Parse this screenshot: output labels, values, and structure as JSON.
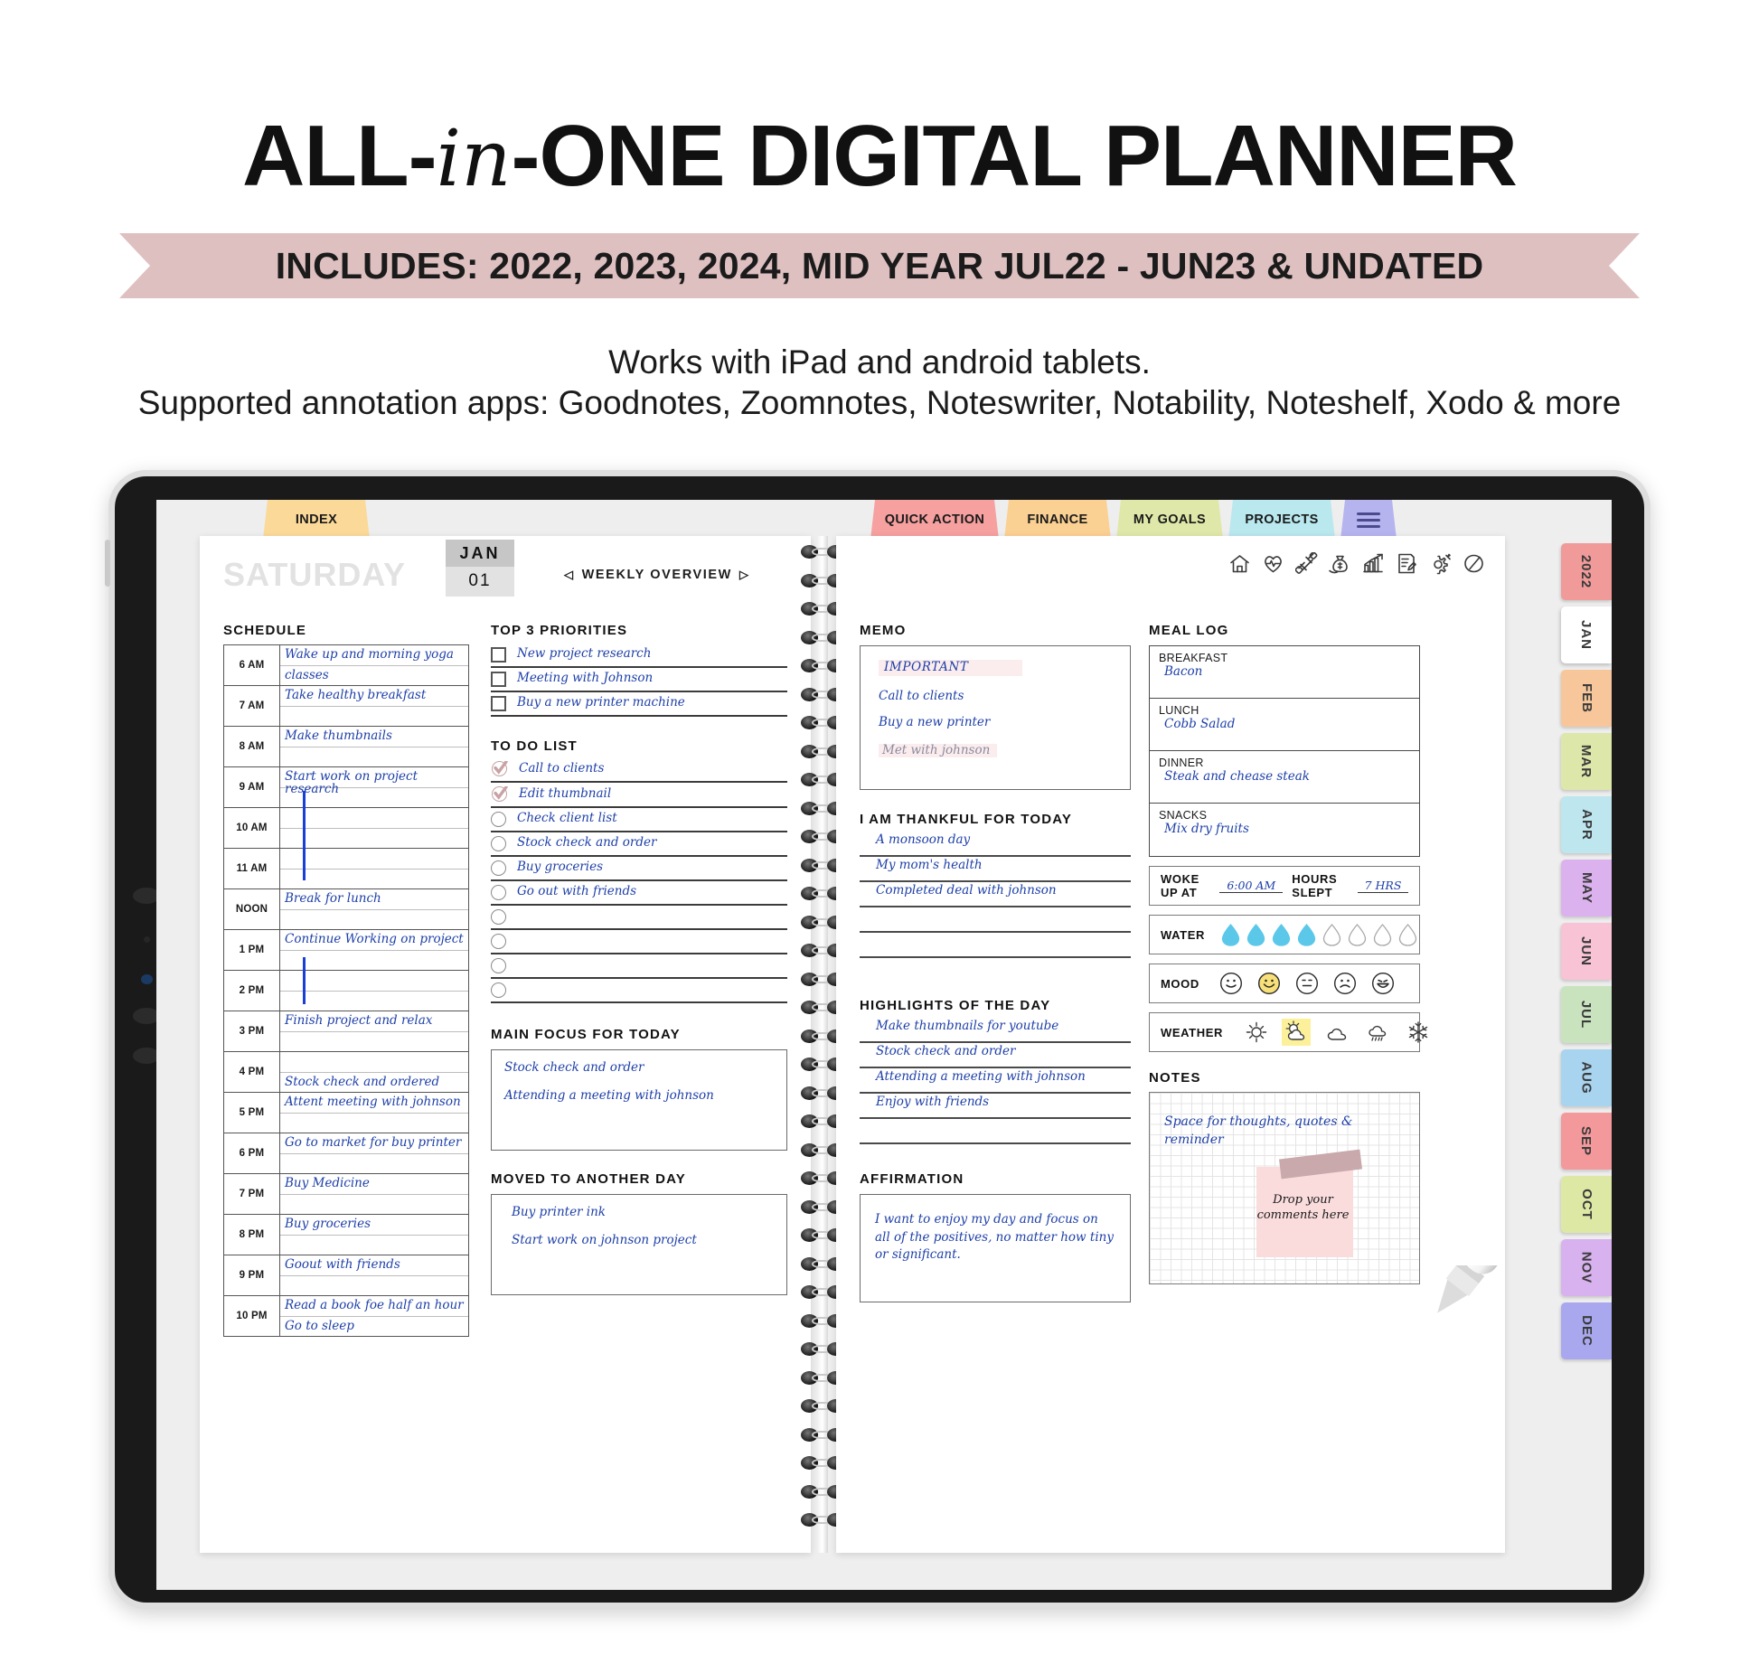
{
  "header": {
    "title_a": "ALL-",
    "title_script": "in",
    "title_b": "-ONE DIGITAL PLANNER",
    "ribbon": "INCLUDES: 2022, 2023, 2024, MID YEAR JUL22 - JUN23 & UNDATED",
    "sub1": "Works with iPad and android tablets.",
    "sub2": "Supported annotation apps: Goodnotes, Zoomnotes, Noteswriter, Notability, Noteshelf, Xodo & more",
    "ribbon_color": "#dfc0c1"
  },
  "top_tabs": [
    {
      "label": "INDEX",
      "color": "#fbd999"
    },
    {
      "label": "QUICK ACTION",
      "color": "#f6a0a0"
    },
    {
      "label": "FINANCE",
      "color": "#fbd093"
    },
    {
      "label": "MY GOALS",
      "color": "#dfe8a8"
    },
    {
      "label": "PROJECTS",
      "color": "#b9e8ee"
    },
    {
      "label": "menu-icon",
      "color": "#b5b4ef"
    }
  ],
  "side_tabs": [
    {
      "label": "2022",
      "color": "#f09a9a"
    },
    {
      "label": "JAN",
      "color": "#ffffff"
    },
    {
      "label": "FEB",
      "color": "#f7c79b"
    },
    {
      "label": "MAR",
      "color": "#dde7a9"
    },
    {
      "label": "APR",
      "color": "#bde6ee"
    },
    {
      "label": "MAY",
      "color": "#dcb2ee"
    },
    {
      "label": "JUN",
      "color": "#f8c3d4"
    },
    {
      "label": "JUL",
      "color": "#c9e3bf"
    },
    {
      "label": "AUG",
      "color": "#a8d4ef"
    },
    {
      "label": "SEP",
      "color": "#f3999c"
    },
    {
      "label": "OCT",
      "color": "#dde8a4"
    },
    {
      "label": "NOV",
      "color": "#d8b2ef"
    },
    {
      "label": "DEC",
      "color": "#a9a8ee"
    }
  ],
  "left_page": {
    "day_name": "SATURDAY",
    "month": "JAN",
    "day_number": "01",
    "weekly_overview": "WEEKLY  OVERVIEW",
    "arrow_prev": "◁",
    "arrow_next": "▷",
    "schedule_title": "SCHEDULE",
    "schedule": [
      {
        "time": "6 AM",
        "line1": "Wake up and morning yoga",
        "line2": "classes"
      },
      {
        "time": "7 AM",
        "line1": "Take healthy breakfast",
        "line2": ""
      },
      {
        "time": "8 AM",
        "line1": "Make thumbnails",
        "line2": ""
      },
      {
        "time": "9 AM",
        "line1": "Start work on project research",
        "line2": ""
      },
      {
        "time": "10 AM",
        "line1": "",
        "line2": ""
      },
      {
        "time": "11 AM",
        "line1": "",
        "line2": ""
      },
      {
        "time": "NOON",
        "line1": "Break for lunch",
        "line2": ""
      },
      {
        "time": "1 PM",
        "line1": "Continue Working on project",
        "line2": ""
      },
      {
        "time": "2 PM",
        "line1": "",
        "line2": ""
      },
      {
        "time": "3 PM",
        "line1": "Finish project and relax",
        "line2": ""
      },
      {
        "time": "4 PM",
        "line1": "",
        "line2": "Stock check and ordered"
      },
      {
        "time": "5 PM",
        "line1": "Attent meeting with johnson",
        "line2": ""
      },
      {
        "time": "6 PM",
        "line1": "Go to market for buy printer",
        "line2": ""
      },
      {
        "time": "7 PM",
        "line1": "Buy Medicine",
        "line2": ""
      },
      {
        "time": "8 PM",
        "line1": "Buy groceries",
        "line2": ""
      },
      {
        "time": "9 PM",
        "line1": "Goout with friends",
        "line2": ""
      },
      {
        "time": "10 PM",
        "line1": "Read a book foe half an hour",
        "line2": "Go to sleep"
      }
    ],
    "priorities_title": "TOP 3 PRIORITIES",
    "priorities": [
      {
        "text": "New project research",
        "checked": false
      },
      {
        "text": "Meeting with Johnson",
        "checked": false
      },
      {
        "text": "Buy a new printer machine",
        "checked": false
      }
    ],
    "todo_title": "TO DO LIST",
    "todo": [
      {
        "text": "Call to clients",
        "done": true
      },
      {
        "text": "Edit thumbnail",
        "done": true
      },
      {
        "text": "Check client list",
        "done": false
      },
      {
        "text": "Stock check and order",
        "done": false
      },
      {
        "text": "Buy groceries",
        "done": false
      },
      {
        "text": "Go out with friends",
        "done": false
      },
      {
        "text": "",
        "done": false
      },
      {
        "text": "",
        "done": false
      },
      {
        "text": "",
        "done": false
      },
      {
        "text": "",
        "done": false
      }
    ],
    "focus_title": "MAIN FOCUS FOR TODAY",
    "focus_items": [
      "Stock check and order",
      "Attending a meeting with johnson"
    ],
    "moved_title": "MOVED TO ANOTHER DAY",
    "moved_items": [
      "Buy printer ink",
      "Start work on johnson project"
    ]
  },
  "right_page": {
    "icons": [
      "home-icon",
      "health-heart-icon",
      "dumbbell-icon",
      "money-bag-icon",
      "growth-chart-icon",
      "notepad-pencil-icon",
      "gear-icon",
      "badge-icon"
    ],
    "memo_title": "MEMO",
    "memo_important": "IMPORTANT",
    "memo_items": [
      {
        "text": "Call to clients",
        "faded": false
      },
      {
        "text": "Buy a new printer",
        "faded": false
      },
      {
        "text": "Met with johnson",
        "faded": true
      }
    ],
    "thankful_title": "I AM THANKFUL  FOR TODAY",
    "thankful": [
      "A monsoon day",
      "My mom's health",
      "Completed deal with johnson",
      "",
      ""
    ],
    "highlights_title": "HIGHLIGHTS  OF  THE  DAY",
    "highlights": [
      "Make thumbnails for youtube",
      "Stock check and order",
      "Attending a meeting with johnson",
      "Enjoy with friends",
      ""
    ],
    "affirmation_title": "AFFIRMATION",
    "affirmation_text": "I want to enjoy my day and focus on all of the positives, no matter how tiny or significant.",
    "meal_title": "MEAL LOG",
    "meals": [
      {
        "label": "BREAKFAST",
        "value": "Bacon"
      },
      {
        "label": "LUNCH",
        "value": "Cobb Salad"
      },
      {
        "label": "DINNER",
        "value": "Steak and chease steak"
      },
      {
        "label": "SNACKS",
        "value": "Mix dry fruits"
      }
    ],
    "woke_label": "WOKE UP AT",
    "woke_value": "6:00 AM",
    "slept_label": "HOURS SLEPT",
    "slept_value": "7 HRS",
    "water_label": "WATER",
    "water_filled": 4,
    "water_total": 8,
    "water_color": "#5bc8ea",
    "mood_label": "MOOD",
    "mood_selected": 1,
    "mood_color": "#f7e07a",
    "moods": [
      "smile",
      "grin",
      "neutral",
      "sad",
      "laugh"
    ],
    "weather_label": "WEATHER",
    "weather_selected": 1,
    "weather_color": "#fcf19a",
    "weathers": [
      "sun-icon",
      "partly-cloudy-icon",
      "cloud-icon",
      "rain-icon",
      "snow-icon"
    ],
    "notes_title": "NOTES",
    "notes_text": "Space for thoughts, quotes & reminder",
    "sticky_text": "Drop your comments here"
  }
}
